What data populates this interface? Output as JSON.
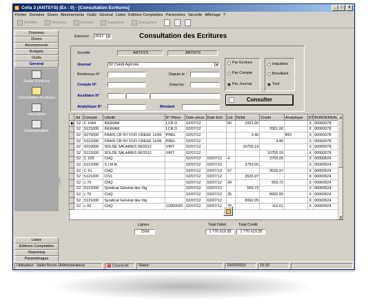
{
  "window": {
    "title": "Celia 3 (ANTSYS) (Ex : 0) - [Consultation Ecritures]",
    "controls": [
      "_",
      "□",
      "×"
    ]
  },
  "menu": [
    "Fichier",
    "Données",
    "Divers",
    "Abonnements",
    "Outils",
    "Général",
    "Listes",
    "Editions Comptables",
    "Paramètres",
    "Sécurité",
    "Affichage",
    "?"
  ],
  "toolbar": {
    "buttons": [
      "Modifier",
      "Nouveau",
      "Annuler",
      "Supprimer",
      "Enregistrer"
    ]
  },
  "nav": {
    "top": [
      "Données",
      "Divers",
      "Abonnements",
      "Budgets",
      "Outils",
      "Général"
    ],
    "active": "Général",
    "items": [
      {
        "label": "Saisie Ecritures",
        "icon": "pen-book-icon"
      },
      {
        "label": "Consultation Ecritures",
        "icon": "magnifier-book-icon"
      },
      {
        "label": "Imputation",
        "icon": "ledger-icon"
      },
      {
        "label": "Désimputation",
        "icon": "unlink-icon"
      }
    ],
    "bottom": [
      "Listes",
      "Editions Comptables",
      "Reporting",
      "Paramétrages"
    ]
  },
  "form": {
    "title": "Consultation des Ecritures",
    "exercice_label": "Exercice",
    "exercice_value": "2012",
    "societe_label": "Société",
    "societe_value1": "ANTSYS",
    "societe_value2": "ANTSYS",
    "journal_label": "Journal",
    "journal_value": "52  Crédit Agricole",
    "bordereau_label": "Bordereau N°",
    "depuis_label": "Depuis le :",
    "jusquau_label": "Jusqu'au :",
    "compte_label": "Compte N°",
    "auxiliaire_label": "Auxiliaire N°",
    "analytique_label": "Analytique N°",
    "montant_label": "Montant",
    "radios_par": [
      {
        "label": "Par Ecriture",
        "checked": false
      },
      {
        "label": "Par Compte",
        "checked": false
      },
      {
        "label": "Par Journal",
        "checked": true
      }
    ],
    "radios_etat": [
      {
        "label": "Imputées",
        "checked": false
      },
      {
        "label": "Brouillard",
        "checked": false
      },
      {
        "label": "Tout",
        "checked": true
      }
    ],
    "consulter_label": "Consulter"
  },
  "grid": {
    "columns": [
      "Jnl",
      "Compte",
      "Libellé",
      "N° Pièce",
      "Date pièce",
      "Date Ech",
      "Let",
      "Débit",
      "Crédit",
      "Analytique",
      "ST",
      "BORDEREAU"
    ],
    "rows": [
      [
        "52",
        "F 1044",
        "INGRAM",
        "LCR D",
        "02/07/12",
        "",
        "60",
        "2001.00",
        "",
        "",
        "X",
        "00000078"
      ],
      [
        "52",
        "5121000",
        "INGRAM",
        "LCR D",
        "02/07/12",
        "",
        "",
        "",
        "2001.00",
        "",
        "X",
        "00000078"
      ],
      [
        "52",
        "6275000",
        "FRAIS CB NY FOO CREEK 11/06",
        "PREL",
        "02/07/12",
        "",
        "",
        "3.40",
        "",
        "BDI",
        "X",
        "00000078"
      ],
      [
        "52",
        "5121000",
        "FRAIS CB NY FOO CREEK 11/06",
        "PREL",
        "02/07/12",
        "",
        "",
        "",
        "3.40",
        "",
        "X",
        "00000078"
      ],
      [
        "52",
        "4210000",
        "SOLDE SALAIRES 06/2012",
        "VIRT",
        "02/07/12",
        "",
        "",
        "10755.19",
        "",
        "",
        "X",
        "00000078"
      ],
      [
        "52",
        "5121000",
        "SOLDE SALAIRES 06/2012",
        "VIRT",
        "02/07/12",
        "",
        "",
        "",
        "10755.19",
        "",
        "X",
        "00000078"
      ],
      [
        "52",
        "C 225",
        "CHQ",
        "",
        "02/07/12",
        "02/07/12",
        "4",
        "",
        "3753.05",
        "",
        "X",
        "00000524"
      ],
      [
        "52",
        "5121000",
        "S.I.M.R.",
        "",
        "02/07/12",
        "02/07/12",
        "",
        "3753.05",
        "",
        "",
        "X",
        "00000524"
      ],
      [
        "52",
        "C 61",
        "CHQ",
        "",
        "02/07/12",
        "02/07/12",
        "57",
        "",
        "3535.97",
        "",
        "X",
        "00000524"
      ],
      [
        "52",
        "5121000",
        "CIVL",
        "",
        "02/07/12",
        "02/07/12",
        "",
        "3535.97",
        "",
        "",
        "X",
        "00000524"
      ],
      [
        "52",
        "c 70",
        "CHQ",
        "",
        "02/07/12",
        "02/07/12",
        "34",
        "",
        "559.72",
        "",
        "X",
        "00000524"
      ],
      [
        "52",
        "5121000",
        "Syndicat Général des Vig",
        "",
        "02/07/12",
        "02/07/12",
        "",
        "559.72",
        "",
        "",
        "X",
        "00000524"
      ],
      [
        "52",
        "c 70",
        "CHQ",
        "",
        "02/07/12",
        "02/07/12",
        "35",
        "",
        "8992.05",
        "",
        "X",
        "00000524"
      ],
      [
        "52",
        "5121000",
        "Syndicat Général des Vig",
        "",
        "02/07/12",
        "02/07/12",
        "",
        "8992.05",
        "",
        "",
        "X",
        "00000524"
      ],
      [
        "52",
        "c 92",
        "CHQ",
        "12060020",
        "02/07/12",
        "02/07/12",
        "28",
        "",
        "116.61",
        "",
        "X",
        "00000524"
      ]
    ]
  },
  "totals": {
    "lignes_label": "Lignes",
    "lignes": "1569",
    "debit_label": "Total Débit",
    "debit": "1 770 619.35",
    "credit_label": "Total Crédit",
    "credit": "1 770 619.35"
  },
  "status": {
    "user": "Utilisateur : Vallet Bruno (Administrateur)",
    "connected": "Connecté",
    "status_label": "Statut :",
    "date": "19/02/2013",
    "time": "15:15"
  }
}
